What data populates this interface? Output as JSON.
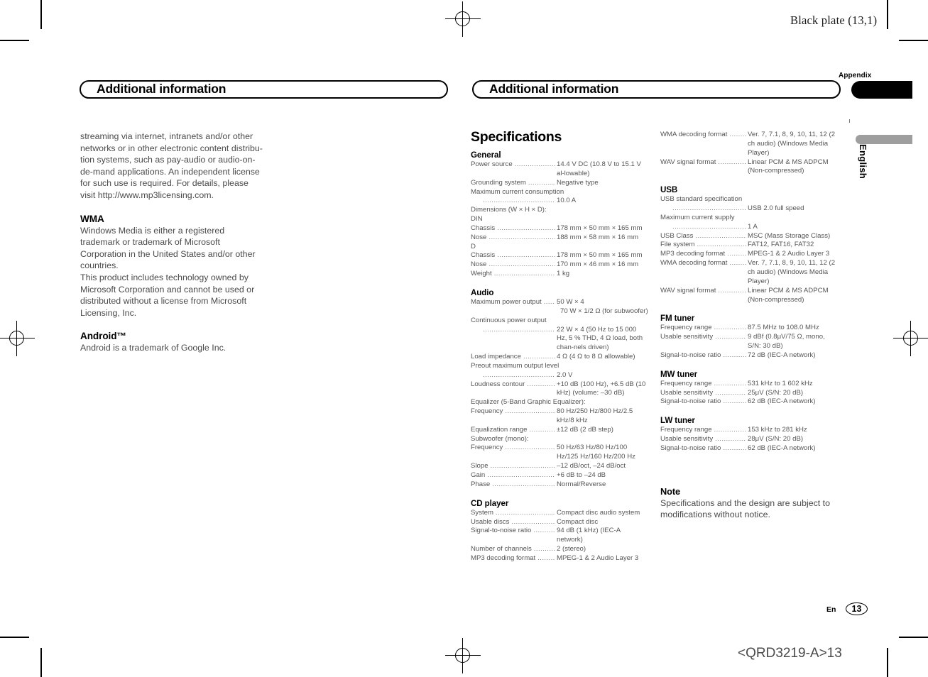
{
  "header": {
    "black_plate": "Black plate (13,1)"
  },
  "tabs": {
    "appendix_label": "Appendix",
    "language_label": "English"
  },
  "left_page": {
    "banner_title": "Additional information",
    "intro_paragraph": "streaming via internet, intranets and/or other networks or in other electronic content distribu-tion systems, such as pay-audio or audio-on-de-mand applications. An independent license for such use is required. For details, please visit http://www.mp3licensing.com.",
    "sections": [
      {
        "heading": "WMA",
        "body": "Windows Media is either a registered trademark or trademark of Microsoft Corporation in the United States and/or other countries.\nThis product includes technology owned by Microsoft Corporation and cannot be used or distributed without a license from Microsoft Licensing, Inc."
      },
      {
        "heading": "Android™",
        "body": "Android is a trademark of Google Inc."
      }
    ]
  },
  "right_page": {
    "banner_title": "Additional information",
    "spec_title": "Specifications",
    "column_a": [
      {
        "heading": "General",
        "rows": [
          {
            "type": "pair",
            "label": "Power source",
            "value": "14.4 V DC (10.8 V to 15.1 V al-lowable)"
          },
          {
            "type": "pair",
            "label": "Grounding system",
            "value": "Negative type"
          },
          {
            "type": "full",
            "text": "Maximum current consumption"
          },
          {
            "type": "indent",
            "value": "10.0 A"
          },
          {
            "type": "full",
            "text": "Dimensions (W × H × D):"
          },
          {
            "type": "full",
            "text": "DIN"
          },
          {
            "type": "pair",
            "label": "Chassis",
            "value": "178 mm × 50 mm × 165 mm"
          },
          {
            "type": "pair",
            "label": "Nose",
            "value": "188 mm × 58 mm × 16 mm"
          },
          {
            "type": "full",
            "text": "D"
          },
          {
            "type": "pair",
            "label": "Chassis",
            "value": "178 mm × 50 mm × 165 mm"
          },
          {
            "type": "pair",
            "label": "Nose",
            "value": "170 mm × 46 mm × 16 mm"
          },
          {
            "type": "pair",
            "label": "Weight",
            "value": "1 kg"
          }
        ]
      },
      {
        "heading": "Audio",
        "rows": [
          {
            "type": "pair",
            "label": "Maximum power output",
            "value": "50 W × 4"
          },
          {
            "type": "cont",
            "text": "70 W × 1/2 Ω (for subwoofer)"
          },
          {
            "type": "full",
            "text": "Continuous power output"
          },
          {
            "type": "indent",
            "value": "22 W × 4 (50 Hz to 15 000 Hz, 5 % THD, 4 Ω load, both chan-nels driven)"
          },
          {
            "type": "pair",
            "label": "Load impedance",
            "value": "4 Ω (4 Ω to 8 Ω allowable)"
          },
          {
            "type": "full",
            "text": "Preout maximum output level"
          },
          {
            "type": "indent",
            "value": "2.0 V"
          },
          {
            "type": "pair",
            "label": "Loudness contour",
            "value": "+10 dB (100 Hz), +6.5 dB (10 kHz) (volume: –30 dB)"
          },
          {
            "type": "full",
            "text": "Equalizer (5-Band Graphic Equalizer):"
          },
          {
            "type": "pair",
            "label": "Frequency",
            "value": "80 Hz/250 Hz/800 Hz/2.5 kHz/8 kHz"
          },
          {
            "type": "pair",
            "label": "Equalization range",
            "value": "±12 dB (2 dB step)"
          },
          {
            "type": "full",
            "text": "Subwoofer (mono):"
          },
          {
            "type": "pair",
            "label": "Frequency",
            "value": "50 Hz/63 Hz/80 Hz/100 Hz/125 Hz/160 Hz/200 Hz"
          },
          {
            "type": "pair",
            "label": "Slope",
            "value": "–12 dB/oct, –24 dB/oct"
          },
          {
            "type": "pair",
            "label": "Gain",
            "value": "+6 dB to –24 dB"
          },
          {
            "type": "pair",
            "label": "Phase",
            "value": "Normal/Reverse"
          }
        ]
      },
      {
        "heading": "CD player",
        "rows": [
          {
            "type": "pair",
            "label": "System",
            "value": "Compact disc audio system"
          },
          {
            "type": "pair",
            "label": "Usable discs",
            "value": "Compact disc"
          },
          {
            "type": "pair",
            "label": "Signal-to-noise ratio",
            "value": "94 dB (1 kHz) (IEC-A network)"
          },
          {
            "type": "pair",
            "label": "Number of channels",
            "value": "2 (stereo)"
          },
          {
            "type": "pair",
            "label": "MP3 decoding format",
            "value": "MPEG-1 & 2 Audio Layer 3"
          }
        ]
      }
    ],
    "column_b": [
      {
        "heading": "",
        "rows": [
          {
            "type": "pair",
            "label": "WMA decoding format",
            "value": "Ver. 7, 7.1, 8, 9, 10, 11, 12 (2 ch audio) (Windows Media Player)"
          },
          {
            "type": "pair",
            "label": "WAV signal format",
            "value": "Linear PCM & MS ADPCM (Non-compressed)"
          }
        ]
      },
      {
        "heading": "USB",
        "rows": [
          {
            "type": "full",
            "text": "USB standard specification"
          },
          {
            "type": "indent",
            "value": "USB 2.0 full speed"
          },
          {
            "type": "full",
            "text": "Maximum current supply"
          },
          {
            "type": "indent",
            "value": "1 A"
          },
          {
            "type": "pair",
            "label": "USB Class",
            "value": "MSC (Mass Storage Class)"
          },
          {
            "type": "pair",
            "label": "File system",
            "value": "FAT12, FAT16, FAT32"
          },
          {
            "type": "pair",
            "label": "MP3 decoding format",
            "value": "MPEG-1 & 2 Audio Layer 3"
          },
          {
            "type": "pair",
            "label": "WMA decoding format",
            "value": "Ver. 7, 7.1, 8, 9, 10, 11, 12 (2 ch audio) (Windows Media Player)"
          },
          {
            "type": "pair",
            "label": "WAV signal format",
            "value": "Linear PCM & MS ADPCM (Non-compressed)"
          }
        ]
      },
      {
        "heading": "FM tuner",
        "rows": [
          {
            "type": "pair",
            "label": "Frequency range",
            "value": "87.5 MHz to 108.0 MHz"
          },
          {
            "type": "pair",
            "label": "Usable sensitivity",
            "value": "9 dBf (0.8μV/75 Ω, mono, S/N: 30 dB)"
          },
          {
            "type": "pair",
            "label": "Signal-to-noise ratio",
            "value": "72 dB (IEC-A network)"
          }
        ]
      },
      {
        "heading": "MW tuner",
        "rows": [
          {
            "type": "pair",
            "label": "Frequency range",
            "value": "531 kHz to 1 602 kHz"
          },
          {
            "type": "pair",
            "label": "Usable sensitivity",
            "value": "25μV (S/N: 20 dB)"
          },
          {
            "type": "pair",
            "label": "Signal-to-noise ratio",
            "value": "62 dB (IEC-A network)"
          }
        ]
      },
      {
        "heading": "LW tuner",
        "rows": [
          {
            "type": "pair",
            "label": "Frequency range",
            "value": "153 kHz to 281 kHz"
          },
          {
            "type": "pair",
            "label": "Usable sensitivity",
            "value": "28μV (S/N: 20 dB)"
          },
          {
            "type": "pair",
            "label": "Signal-to-noise ratio",
            "value": "62 dB (IEC-A network)"
          }
        ]
      }
    ],
    "note": {
      "heading": "Note",
      "body": "Specifications and the design are subject to modifications without notice."
    }
  },
  "footer": {
    "language_code": "En",
    "page_number": "13",
    "part_code": "<QRD3219-A>13"
  }
}
